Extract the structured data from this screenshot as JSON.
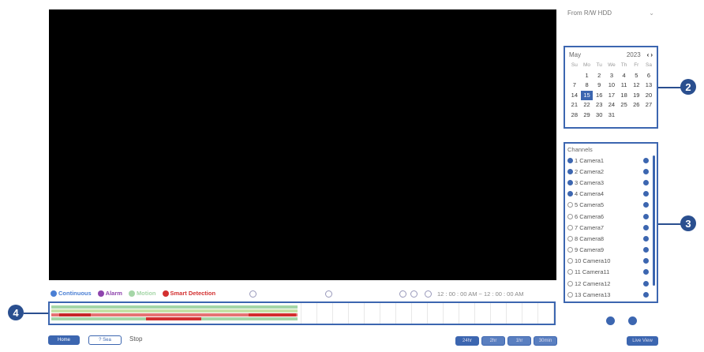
{
  "source_select": {
    "value": "From R/W HDD"
  },
  "calendar": {
    "month": "May",
    "year": "2023",
    "weekdays": [
      "Su",
      "Mo",
      "Tu",
      "We",
      "Th",
      "Fr",
      "Sa"
    ],
    "selected_day": "15",
    "days": [
      "",
      "1",
      "2",
      "3",
      "4",
      "5",
      "6",
      "7",
      "8",
      "9",
      "10",
      "11",
      "12",
      "13",
      "14",
      "15",
      "16",
      "17",
      "18",
      "19",
      "20",
      "21",
      "22",
      "23",
      "24",
      "25",
      "26",
      "27",
      "28",
      "29",
      "30",
      "31"
    ]
  },
  "channels": {
    "title": "Channels",
    "items": [
      {
        "label": "1 Camera1",
        "checked": true
      },
      {
        "label": "2 Camera2",
        "checked": true
      },
      {
        "label": "3 Camera3",
        "checked": true
      },
      {
        "label": "4 Camera4",
        "checked": true
      },
      {
        "label": "5 Camera5",
        "checked": false
      },
      {
        "label": "6 Camera6",
        "checked": false
      },
      {
        "label": "7 Camera7",
        "checked": false
      },
      {
        "label": "8 Camera8",
        "checked": false
      },
      {
        "label": "9 Camera9",
        "checked": false
      },
      {
        "label": "10 Camera10",
        "checked": false
      },
      {
        "label": "11 Camera11",
        "checked": false
      },
      {
        "label": "12 Camera12",
        "checked": false
      },
      {
        "label": "13 Camera13",
        "checked": false
      }
    ]
  },
  "legend": [
    {
      "label": "Continuous",
      "color": "#4a7fd4"
    },
    {
      "label": "Alarm",
      "color": "#8e44ad"
    },
    {
      "label": "Motion",
      "color": "#a5d6a7"
    },
    {
      "label": "Smart Detection",
      "color": "#d32f2f"
    }
  ],
  "time_range": "12 : 00 : 00 AM  ~  12 : 00 : 00 AM",
  "callouts": [
    "2",
    "3",
    "4"
  ],
  "bottom": {
    "status": "Stop",
    "left_btn1": "Home",
    "left_btn2": "? Sea",
    "zoom_buttons": [
      "24hr",
      "2hr",
      "1hr",
      "30min"
    ],
    "live_button": "Live View"
  },
  "colors": {
    "accent": "#3c66b0",
    "callout": "#2a4f8f"
  }
}
